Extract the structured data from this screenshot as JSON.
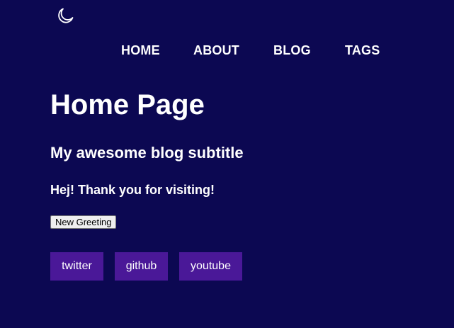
{
  "theme_toggle": {
    "icon": "moon-icon"
  },
  "nav": {
    "items": [
      {
        "label": "HOME"
      },
      {
        "label": "ABOUT"
      },
      {
        "label": "BLOG"
      },
      {
        "label": "TAGS"
      }
    ]
  },
  "main": {
    "title": "Home Page",
    "subtitle": "My awesome blog subtitle",
    "greeting": "Hej! Thank you for visiting!",
    "greeting_button_label": "New Greeting"
  },
  "social": {
    "links": [
      {
        "label": "twitter"
      },
      {
        "label": "github"
      },
      {
        "label": "youtube"
      }
    ]
  },
  "colors": {
    "background": "#0c0852",
    "text": "#ffffff",
    "social_button": "#4a1898",
    "button_face": "#efefef"
  }
}
